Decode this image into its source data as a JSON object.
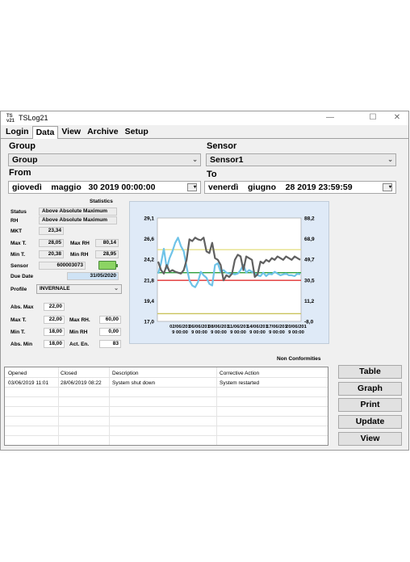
{
  "window": {
    "title": "TSLog21",
    "icon_text": "TS\nv21",
    "min": "—",
    "max": "☐",
    "close": "✕"
  },
  "tabs": [
    "Login",
    "Data",
    "View",
    "Archive",
    "Setup"
  ],
  "filters": {
    "group_label": "Group",
    "group_value": "Group",
    "sensor_label": "Sensor",
    "sensor_value": "Sensor1",
    "from_label": "From",
    "from_value": "giovedì    maggio   30 2019 00:00:00",
    "to_label": "To",
    "to_value": "venerdì    giugno    28 2019 23:59:59"
  },
  "statistics": {
    "heading": "Statistics",
    "status_label": "Status",
    "status_value": "Above Absolute Maximum",
    "rh_label": "RH",
    "rh_value": "Above Absolute Maximum",
    "mkt_label": "MKT",
    "mkt_value": "23,34",
    "maxt_label": "Max T.",
    "maxt_value": "28,05",
    "maxrh_label": "Max RH",
    "maxrh_value": "80,14",
    "mint_label": "Min T.",
    "mint_value": "20,38",
    "minrh_label": "Min RH",
    "minrh_value": "28,95",
    "sensor_label": "Sensor",
    "sensor_value": "600003073",
    "due_label": "Due Date",
    "due_value": "31/05/2020"
  },
  "profile": {
    "label": "Profile",
    "value": "INVERNALE",
    "absmax_label": "Abs. Max",
    "absmax_value": "22,00",
    "maxt_label": "Max T.",
    "maxt_value": "22,00",
    "maxrh_label": "Max RH.",
    "maxrh_value": "60,00",
    "mint_label": "Min T.",
    "mint_value": "18,00",
    "minrh_label": "Min RH",
    "minrh_value": "0,00",
    "absmin_label": "Abs. Min",
    "absmin_value": "18,00",
    "acten_label": "Act. En.",
    "acten_value": "83"
  },
  "chart_data": {
    "type": "line",
    "y_left_ticks": [
      "29,1",
      "26,6",
      "24,2",
      "21,8",
      "19,4",
      "17,0"
    ],
    "y_right_ticks": [
      "88,2",
      "68,9",
      "49,7",
      "30,5",
      "11,2",
      "-8,0"
    ],
    "ylim_left": [
      17.0,
      29.1
    ],
    "ylim_right": [
      -8.0,
      88.2
    ],
    "x_ticks": [
      "02/06/201\n9 00:00",
      "06/06/201\n9 00:00",
      "08/06/201\n9 00:00",
      "11/06/201\n9 00:00",
      "14/06/201\n9 00:00",
      "17/06/201\n9 00:00",
      "20/06/201\n9 00:00"
    ],
    "thresholds": [
      {
        "value": 25.4,
        "color": "#e6e08a"
      },
      {
        "value": 22.7,
        "color": "#2e9e3a"
      },
      {
        "value": 21.8,
        "color": "#e03030"
      },
      {
        "value": 17.9,
        "color": "#c9c25a"
      }
    ],
    "series": [
      {
        "color": "#6fc3e8",
        "axis": "left",
        "values": [
          22.6,
          23.8,
          25.5,
          23.2,
          24.4,
          25.2,
          26.2,
          26.8,
          25.8,
          25.2,
          23.4,
          21.8,
          21.2,
          21.0,
          21.6,
          22.8,
          22.4,
          22.1,
          21.4,
          21.2,
          23.6,
          23.8,
          22.8,
          23.0,
          22.7,
          22.6,
          22.6,
          22.5,
          22.6,
          23.0,
          23.6,
          22.7,
          23.0,
          22.8,
          22.6,
          22.4,
          22.3,
          22.7,
          22.3,
          22.6,
          22.5,
          22.8,
          22.6,
          22.4,
          22.5,
          22.6,
          22.4,
          22.4,
          22.3,
          22.6,
          22.5
        ]
      },
      {
        "color": "#606060",
        "axis": "left",
        "values": [
          24.0,
          23.0,
          22.6,
          23.6,
          22.8,
          23.0,
          22.8,
          22.7,
          22.6,
          23.0,
          24.2,
          26.6,
          26.4,
          26.8,
          26.6,
          26.5,
          26.8,
          25.2,
          25.0,
          26.2,
          24.4,
          24.2,
          23.6,
          21.8,
          22.4,
          22.2,
          22.6,
          24.2,
          24.8,
          24.6,
          23.0,
          24.6,
          24.4,
          24.2,
          22.2,
          22.5,
          24.0,
          23.8,
          24.2,
          24.0,
          24.4,
          24.2,
          24.6,
          24.4,
          24.2,
          24.6,
          24.4,
          24.2,
          24.6,
          24.4,
          24.2
        ]
      }
    ]
  },
  "nonconformities": {
    "heading": "Non Conformities",
    "columns": [
      "Opened",
      "Closed",
      "Description",
      "Corrective Action"
    ],
    "rows": [
      {
        "opened": "03/06/2019 11:01",
        "closed": "28/06/2019 08:22",
        "description": "System shut down",
        "action": "System restarted"
      }
    ]
  },
  "buttons": [
    "Table",
    "Graph",
    "Print",
    "Update",
    "View"
  ]
}
